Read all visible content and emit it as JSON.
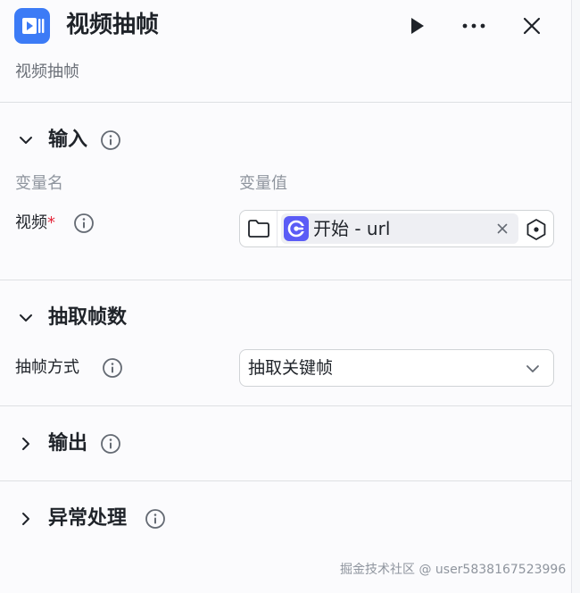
{
  "header": {
    "title": "视频抽帧",
    "subtitle": "视频抽帧",
    "app_icon": "video-icon",
    "run_icon": "play-icon",
    "more_icon": "more-icon",
    "close_icon": "close-icon",
    "accent_color": "#3c7bf6"
  },
  "input_section": {
    "title": "输入",
    "col_name": "变量名",
    "col_value": "变量值",
    "field": {
      "label": "视频",
      "required_mark": "*",
      "tag_text": "开始 - url",
      "tag_icon": "start-node-icon",
      "tag_icon_color": "#5b5cf6"
    }
  },
  "frame_section": {
    "title": "抽取帧数",
    "field_label": "抽帧方式",
    "select_value": "抽取关键帧"
  },
  "output_section": {
    "title": "输出"
  },
  "error_section": {
    "title": "异常处理"
  },
  "watermark": "掘金技术社区 @ user5838167523996"
}
